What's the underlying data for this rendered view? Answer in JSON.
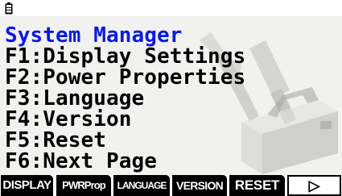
{
  "menu": {
    "title": "System Manager",
    "items": [
      {
        "label": "F1:Display Settings"
      },
      {
        "label": "F2:Power Properties"
      },
      {
        "label": "F3:Language"
      },
      {
        "label": "F4:Version"
      },
      {
        "label": "F5:Reset"
      },
      {
        "label": "F6:Next Page"
      }
    ]
  },
  "softkeys": [
    {
      "label": "DISPLAY"
    },
    {
      "label": "PWRProp"
    },
    {
      "label": "LANGUAGE"
    },
    {
      "label": "VERSION"
    },
    {
      "label": "RESET"
    },
    {
      "label": "▷"
    }
  ],
  "icons": {
    "battery": "battery-icon",
    "next": "right-triangle-icon"
  },
  "colors": {
    "title": "#0a1ae0",
    "text": "#000000",
    "background": "#f1f1ef",
    "softkey_bg": "#000000",
    "softkey_text": "#ffffff"
  }
}
